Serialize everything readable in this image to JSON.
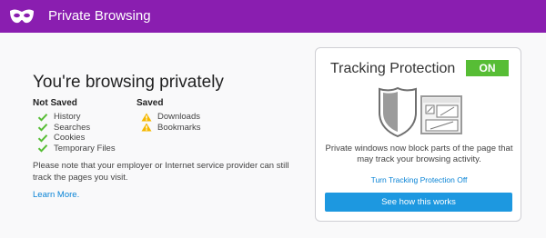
{
  "header": {
    "title": "Private Browsing",
    "icon": "private-mask-icon",
    "bg_color": "#8a1eb0"
  },
  "main": {
    "headline": "You're browsing privately",
    "not_saved": {
      "title": "Not Saved",
      "icon": "check-icon",
      "items": [
        "History",
        "Searches",
        "Cookies",
        "Temporary Files"
      ]
    },
    "saved": {
      "title": "Saved",
      "icon": "warning-icon",
      "items": [
        "Downloads",
        "Bookmarks"
      ]
    },
    "note": "Please note that your employer or Internet service provider can still track the pages you visit.",
    "learn_more": "Learn More."
  },
  "tracking": {
    "title": "Tracking Protection",
    "toggle_label": "ON",
    "toggle_color": "#57bd35",
    "description": "Private windows now block parts of the page that may track your browsing activity.",
    "turn_off_link": "Turn Tracking Protection Off",
    "cta_label": "See how this works",
    "cta_color": "#1d98e0"
  }
}
